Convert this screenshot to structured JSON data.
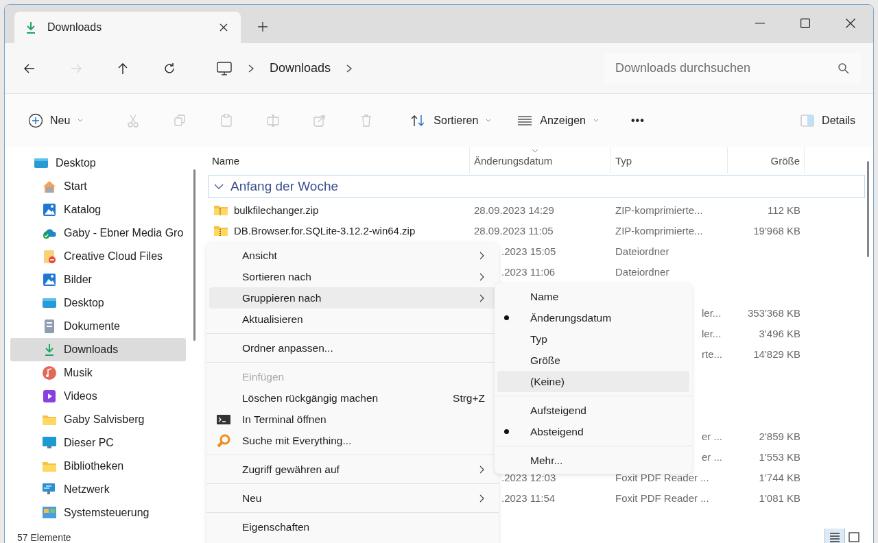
{
  "window": {
    "tab": {
      "title": "Downloads",
      "selected": true
    }
  },
  "nav": [
    {
      "kind": "back",
      "disabled": false
    },
    {
      "kind": "forward",
      "disabled": true
    },
    {
      "kind": "up",
      "disabled": false
    },
    {
      "kind": "refresh",
      "disabled": false
    }
  ],
  "breadcrumb": [
    "Downloads"
  ],
  "search": {
    "placeholder": "Downloads durchsuchen"
  },
  "toolbar": {
    "new_label": "Neu",
    "actions": [
      {
        "kind": "cut",
        "disabled": true
      },
      {
        "kind": "copy",
        "disabled": true
      },
      {
        "kind": "paste",
        "disabled": true
      },
      {
        "kind": "rename",
        "disabled": true
      },
      {
        "kind": "share",
        "disabled": true
      },
      {
        "kind": "delete",
        "disabled": true
      }
    ],
    "sort_label": "Sortieren",
    "view_label": "Anzeigen",
    "more_label": "•••",
    "details_label": "Details"
  },
  "sidebar": {
    "items": [
      {
        "label": "Desktop",
        "kind": "desktop",
        "selected": false,
        "children": [
          {
            "label": "Start",
            "kind": "home",
            "selected": false
          },
          {
            "label": "Katalog",
            "kind": "picture",
            "selected": false
          },
          {
            "label": "Gaby - Ebner Media Gro",
            "kind": "cloud",
            "selected": false
          },
          {
            "label": "Creative Cloud Files",
            "kind": "ccfolder",
            "selected": false
          },
          {
            "label": "Bilder",
            "kind": "picture",
            "selected": false
          },
          {
            "label": "Desktop",
            "kind": "desktop",
            "selected": false
          },
          {
            "label": "Dokumente",
            "kind": "document",
            "selected": false
          },
          {
            "label": "Downloads",
            "kind": "download",
            "selected": true
          },
          {
            "label": "Musik",
            "kind": "music",
            "selected": false
          },
          {
            "label": "Videos",
            "kind": "video",
            "selected": false
          },
          {
            "label": "Gaby Salvisberg",
            "kind": "folder",
            "selected": false
          },
          {
            "label": "Dieser PC",
            "kind": "monitor",
            "selected": false
          },
          {
            "label": "Bibliotheken",
            "kind": "folder",
            "selected": false
          },
          {
            "label": "Netzwerk",
            "kind": "network",
            "selected": false
          },
          {
            "label": "Systemsteuerung",
            "kind": "control",
            "selected": false
          }
        ]
      }
    ]
  },
  "table": {
    "columns": [
      {
        "label": "Name",
        "sorted": false
      },
      {
        "label": "Änderungsdatum",
        "sorted": true
      },
      {
        "label": "Typ",
        "sorted": false
      },
      {
        "label": "Größe",
        "sorted": false
      }
    ],
    "group": {
      "label": "Anfang der Woche",
      "expanded": true
    },
    "rows": [
      {
        "kind": "full",
        "name": "bulkfilechanger.zip",
        "date": "28.09.2023 14:29",
        "type": "ZIP-komprimierte...",
        "size": "112 KB"
      },
      {
        "kind": "full",
        "name": "DB.Browser.for.SQLite-3.12.2-win64.zip",
        "date": "28.09.2023 11:05",
        "type": "ZIP-komprimierte...",
        "size": "19'968 KB"
      },
      {
        "kind": "under-menu",
        "date": ".2023 15:05",
        "type": "Dateiordner"
      },
      {
        "kind": "under-menu",
        "date": ".2023 11:06",
        "type": "Dateiordner"
      },
      {
        "kind": "hidden"
      },
      {
        "kind": "under-both",
        "type": "ler...",
        "size": "353'368 KB"
      },
      {
        "kind": "under-both",
        "type": "ler...",
        "size": "3'496 KB"
      },
      {
        "kind": "under-both",
        "type": "rte...",
        "size": "14'829 KB"
      },
      {
        "kind": "hidden"
      },
      {
        "kind": "hidden"
      },
      {
        "kind": "hidden"
      },
      {
        "kind": "under-both",
        "type": "er ...",
        "size": "2'859 KB"
      },
      {
        "kind": "under-both",
        "type": "er ...",
        "size": "1'553 KB"
      },
      {
        "kind": "under-menu",
        "date": ".2023 12:03",
        "type": "Foxit PDF Reader ...",
        "size": "1'744 KB"
      },
      {
        "kind": "under-menu",
        "date": ".2023 11:54",
        "type": "Foxit PDF Reader ...",
        "size": "1'081 KB"
      }
    ]
  },
  "context_menu": {
    "items": [
      {
        "kind": "item",
        "label": "Ansicht",
        "submenu": true,
        "highlighted": false
      },
      {
        "kind": "item",
        "label": "Sortieren nach",
        "submenu": true,
        "highlighted": false
      },
      {
        "kind": "item",
        "label": "Gruppieren nach",
        "submenu": true,
        "highlighted": true
      },
      {
        "kind": "item",
        "label": "Aktualisieren",
        "submenu": false,
        "highlighted": false
      },
      {
        "kind": "separator"
      },
      {
        "kind": "item",
        "label": "Ordner anpassen...",
        "submenu": false,
        "highlighted": false
      },
      {
        "kind": "separator"
      },
      {
        "kind": "item",
        "label": "Einfügen",
        "submenu": false,
        "highlighted": false,
        "disabled": true
      },
      {
        "kind": "item",
        "label": "Löschen rückgängig machen",
        "shortcut": "Strg+Z",
        "submenu": false,
        "highlighted": false
      },
      {
        "kind": "terminal",
        "label": "In Terminal öffnen",
        "submenu": false,
        "highlighted": false
      },
      {
        "kind": "search-orange",
        "label": "Suche mit Everything...",
        "submenu": false,
        "highlighted": false
      },
      {
        "kind": "separator"
      },
      {
        "kind": "item",
        "label": "Zugriff gewähren auf",
        "submenu": true,
        "highlighted": false
      },
      {
        "kind": "separator"
      },
      {
        "kind": "item",
        "label": "Neu",
        "submenu": true,
        "highlighted": false
      },
      {
        "kind": "separator"
      },
      {
        "kind": "item",
        "label": "Eigenschaften",
        "submenu": false,
        "highlighted": false
      }
    ]
  },
  "submenu": {
    "items": [
      {
        "kind": "item",
        "label": "Name",
        "selected": false,
        "highlighted": false
      },
      {
        "kind": "item",
        "label": "Änderungsdatum",
        "selected": true,
        "highlighted": false
      },
      {
        "kind": "item",
        "label": "Typ",
        "selected": false,
        "highlighted": false
      },
      {
        "kind": "item",
        "label": "Größe",
        "selected": false,
        "highlighted": false
      },
      {
        "kind": "item",
        "label": "(Keine)",
        "selected": false,
        "highlighted": true
      },
      {
        "kind": "separator"
      },
      {
        "kind": "item",
        "label": "Aufsteigend",
        "selected": false,
        "highlighted": false
      },
      {
        "kind": "item",
        "label": "Absteigend",
        "selected": true,
        "highlighted": false
      },
      {
        "kind": "separator"
      },
      {
        "kind": "item",
        "label": "Mehr...",
        "selected": false,
        "highlighted": false
      }
    ]
  },
  "status_bar": {
    "count": "57 Elemente",
    "views": [
      {
        "kind": "details",
        "selected": true
      },
      {
        "kind": "tiles",
        "selected": false
      }
    ]
  }
}
